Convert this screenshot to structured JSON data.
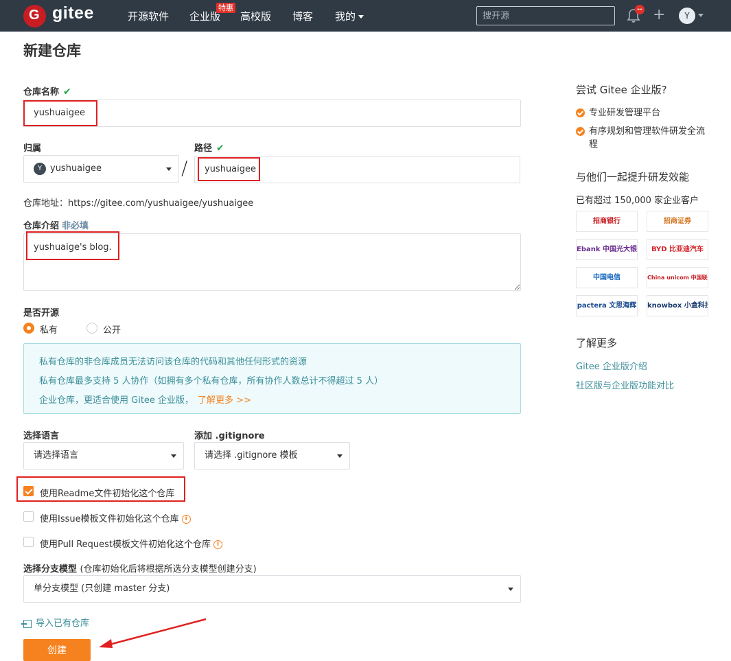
{
  "nav": {
    "brand": "gitee",
    "logo_letter": "G",
    "items": [
      "开源软件",
      "企业版",
      "高校版",
      "博客",
      "我的"
    ],
    "sale_badge": "特惠",
    "search_placeholder": "搜开源",
    "notification_badge": "--",
    "avatar_letter": "Y"
  },
  "page": {
    "title": "新建仓库"
  },
  "form": {
    "repo_name_label": "仓库名称",
    "repo_name_value": "yushuaigee",
    "owner_label": "归属",
    "owner_value": "yushuaigee",
    "owner_avatar": "Y",
    "path_label": "路径",
    "path_value": "yushuaigee",
    "slash": "/",
    "repo_address": "仓库地址：https://gitee.com/yushuaigee/yushuaigee",
    "desc_label": "仓库介绍",
    "desc_optional": "非必填",
    "desc_value": "yushuaige's blog.",
    "open_source_label": "是否开源",
    "private_label": "私有",
    "public_label": "公开",
    "info_lines": [
      "私有仓库的非仓库成员无法访问该仓库的代码和其他任何形式的资源",
      "私有仓库最多支持 5 人协作（如拥有多个私有仓库，所有协作人数总计不得超过 5 人）",
      "企业仓库，更适合使用 Gitee 企业版，"
    ],
    "info_link": "了解更多 >>",
    "language_label": "选择语言",
    "language_value": "请选择语言",
    "gitignore_label": "添加 .gitignore",
    "gitignore_value": "请选择 .gitignore 模板",
    "readme_check": "使用Readme文件初始化这个仓库",
    "issue_check": "使用Issue模板文件初始化这个仓库",
    "pr_check": "使用Pull Request模板文件初始化这个仓库",
    "branch_label": "选择分支模型",
    "branch_hint": "(仓库初始化后将根据所选分支模型创建分支)",
    "branch_value": "单分支模型 (只创建 master 分支)",
    "import_link": "导入已有仓库",
    "create_button": "创建"
  },
  "sidebar": {
    "try_title": "尝试 Gitee 企业版?",
    "features": [
      "专业研发管理平台",
      "有序规划和管理软件研发全流程"
    ],
    "together_title": "与他们一起提升研发效能",
    "customers": "已有超过 150,000 家企业客户",
    "logos": [
      "招商银行",
      "招商证券",
      "Ebank 中国光大银行",
      "BYD 比亚迪汽车",
      "中国电信",
      "China unicom 中国联通",
      "pactera 文思海辉",
      "knowbox 小盒科技"
    ],
    "learn_title": "了解更多",
    "links": [
      "Gitee 企业版介绍",
      "社区版与企业版功能对比"
    ]
  }
}
